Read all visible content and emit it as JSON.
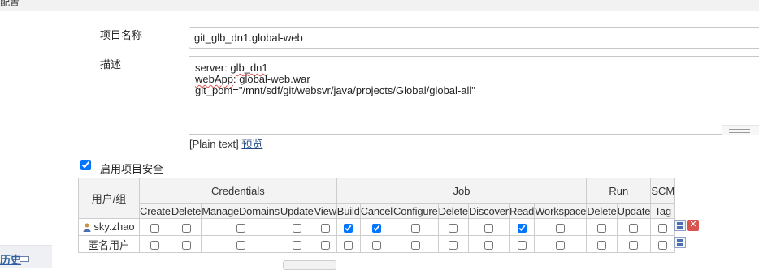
{
  "header": {
    "title": "配置"
  },
  "form": {
    "project_name_label": "项目名称",
    "project_name_value": "git_glb_dn1.global-web",
    "description_label": "描述",
    "description_lines": [
      {
        "key": "server",
        "sep": ": ",
        "val": "glb_dn1"
      },
      {
        "key": "webApp",
        "sep": ": ",
        "val": "global-web.war"
      },
      {
        "key": "git_pom",
        "sep": "=",
        "val": "\"/mnt/sdf/git/websvr/java/projects/Global/global-all\""
      }
    ],
    "plain_text_label": "[Plain text]",
    "preview_link": "预览",
    "enable_security_label": "启用项目安全",
    "enable_security_checked": true
  },
  "matrix": {
    "user_group_header": "用户/组",
    "groups": [
      {
        "name": "Credentials",
        "columns": [
          "Create",
          "Delete",
          "ManageDomains",
          "Update",
          "View"
        ]
      },
      {
        "name": "Job",
        "columns": [
          "Build",
          "Cancel",
          "Configure",
          "Delete",
          "Discover",
          "Read",
          "Workspace"
        ]
      },
      {
        "name": "Run",
        "columns": [
          "Delete",
          "Update"
        ]
      },
      {
        "name": "SCM",
        "columns": [
          "Tag"
        ]
      }
    ],
    "rows": [
      {
        "name": "sky.zhao",
        "icon": "person-icon",
        "checked": [
          false,
          false,
          false,
          false,
          false,
          true,
          true,
          false,
          false,
          false,
          true,
          false,
          false,
          false,
          false
        ],
        "removable": true
      },
      {
        "name": "匿名用户",
        "icon": null,
        "checked": [
          false,
          false,
          false,
          false,
          false,
          false,
          false,
          false,
          false,
          false,
          false,
          false,
          false,
          false,
          false
        ],
        "removable": false
      }
    ]
  },
  "sidebar": {
    "history_label": "历史"
  },
  "colors": {
    "link": "#204a87",
    "remove": "#d9534f",
    "table_border": "#cdcdcd",
    "header_bg": "#f3f3f3"
  }
}
